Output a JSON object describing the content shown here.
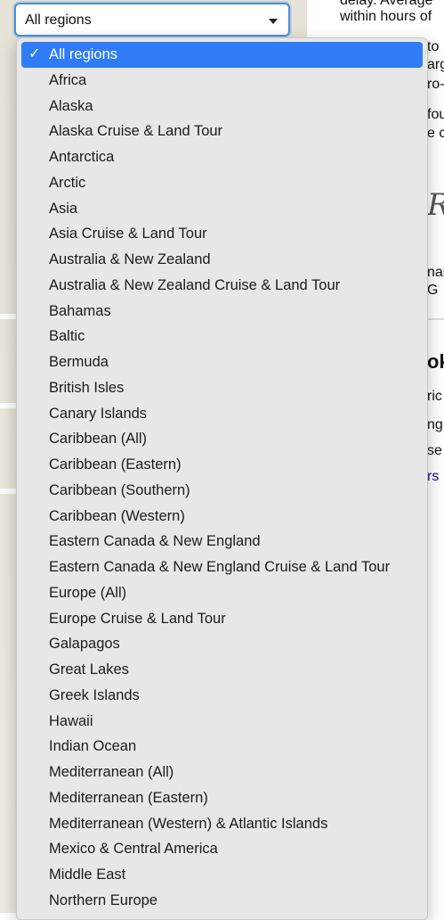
{
  "select": {
    "value": "All regions",
    "arrow_icon": "caret-down-icon"
  },
  "menu": {
    "check_icon": "✓",
    "options": [
      "All regions",
      "Africa",
      "Alaska",
      "Alaska Cruise & Land Tour",
      "Antarctica",
      "Arctic",
      "Asia",
      "Asia Cruise & Land Tour",
      "Australia & New Zealand",
      "Australia & New Zealand Cruise & Land Tour",
      "Bahamas",
      "Baltic",
      "Bermuda",
      "British Isles",
      "Canary Islands",
      "Caribbean (All)",
      "Caribbean (Eastern)",
      "Caribbean (Southern)",
      "Caribbean (Western)",
      "Eastern Canada & New England",
      "Eastern Canada & New England Cruise & Land Tour",
      "Europe (All)",
      "Europe Cruise & Land Tour",
      "Galapagos",
      "Great Lakes",
      "Greek Islands",
      "Hawaii",
      "Indian Ocean",
      "Mediterranean (All)",
      "Mediterranean (Eastern)",
      "Mediterranean (Western) & Atlantic Islands",
      "Mexico & Central America",
      "Middle East",
      "Northern Europe"
    ],
    "selected_index": 0,
    "selected_color": "#2f7cf6"
  },
  "background": {
    "line1": "delay. Average",
    "line2": "within hours of",
    "frag_to": "to",
    "frag_arg": "arg",
    "frag_ro": "ro-",
    "frag_fou": "fou",
    "frag_ec": "e c",
    "frag_script": "R",
    "frag_nai": "nai",
    "frag_g": "G",
    "frag_heading": "ok",
    "frag_ric": "ric",
    "frag_ng": "ng",
    "frag_se": "se",
    "frag_link": "rs"
  }
}
